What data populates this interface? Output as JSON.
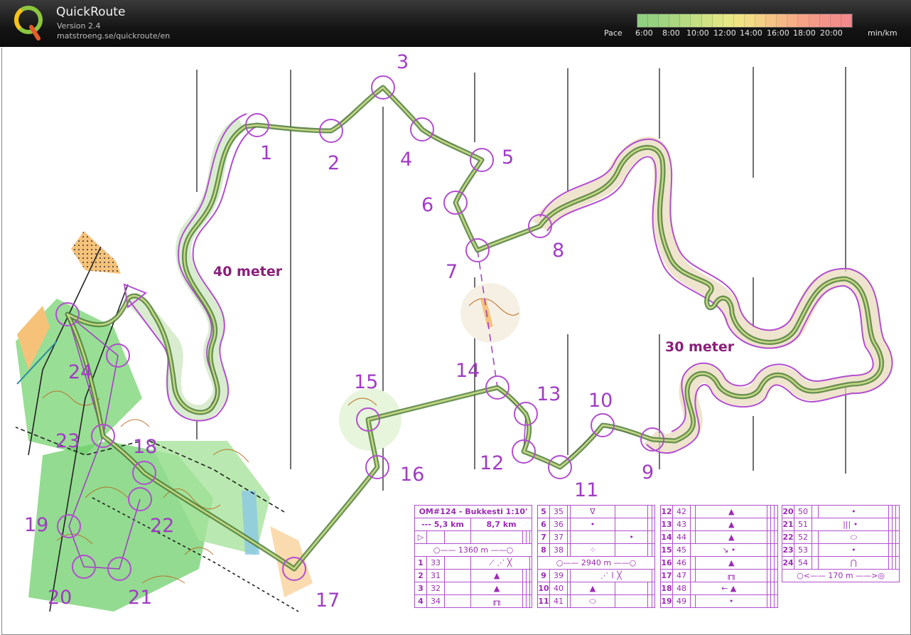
{
  "app": {
    "title": "QuickRoute",
    "version": "Version 2.4",
    "url": "matstroeng.se/quickroute/en"
  },
  "pace": {
    "label": "Pace",
    "ticks": [
      "6:00",
      "8:00",
      "10:00",
      "12:00",
      "14:00",
      "16:00",
      "18:00",
      "20:00"
    ],
    "unit": "min/km",
    "colors": [
      "#8fcf7f",
      "#96d180",
      "#a0d480",
      "#abd781",
      "#b7db82",
      "#c4de83",
      "#d1e284",
      "#dde585",
      "#e8e786",
      "#efe386",
      "#f2da86",
      "#f4cf86",
      "#f5c486",
      "#f6b986",
      "#f6ae87",
      "#f6a388",
      "#f59a89",
      "#f4938a",
      "#f38e8b",
      "#f2898c"
    ]
  },
  "map": {
    "route_color": "#4f7f3a",
    "course_color": "#a13bc4",
    "height_labels": [
      "40 meter",
      "30 meter"
    ],
    "controls": [
      {
        "label": "1"
      },
      {
        "label": "2"
      },
      {
        "label": "3"
      },
      {
        "label": "4"
      },
      {
        "label": "5"
      },
      {
        "label": "6"
      },
      {
        "label": "7"
      },
      {
        "label": "8"
      },
      {
        "label": "9"
      },
      {
        "label": "10"
      },
      {
        "label": "11"
      },
      {
        "label": "12"
      },
      {
        "label": "13"
      },
      {
        "label": "14"
      },
      {
        "label": "15"
      },
      {
        "label": "16"
      },
      {
        "label": "17"
      },
      {
        "label": "18"
      },
      {
        "label": "19"
      },
      {
        "label": "20"
      },
      {
        "label": "21"
      },
      {
        "label": "22"
      },
      {
        "label": "23"
      },
      {
        "label": "24"
      }
    ]
  },
  "descriptions": {
    "title": "OM#124 - Bukkesti 1:10'",
    "length1": "--- 5,3 km",
    "length2": "8,7 km",
    "leg1": "1360 m",
    "leg2": "2940 m",
    "leg3": "170 m",
    "col1": [
      {
        "n": "1",
        "code": "33",
        "sym": "⟋ ⋰ ╳"
      },
      {
        "n": "2",
        "code": "31",
        "sym": "▲"
      },
      {
        "n": "3",
        "code": "32",
        "sym": "▲"
      },
      {
        "n": "4",
        "code": "34",
        "sym": "╓╖"
      }
    ],
    "col2": [
      {
        "n": "5",
        "code": "35",
        "sym": "∇"
      },
      {
        "n": "6",
        "code": "36",
        "sym": "•"
      },
      {
        "n": "7",
        "code": "37",
        "sym": "•"
      },
      {
        "n": "8",
        "code": "38",
        "sym": "⁘"
      },
      {
        "n": "9",
        "code": "39",
        "sym": "⋰ ⌇ ╳"
      },
      {
        "n": "10",
        "code": "40",
        "sym": "▲"
      },
      {
        "n": "11",
        "code": "41",
        "sym": "⬭"
      }
    ],
    "col3": [
      {
        "n": "12",
        "code": "42",
        "sym": "▲"
      },
      {
        "n": "13",
        "code": "43",
        "sym": "▲"
      },
      {
        "n": "14",
        "code": "44",
        "sym": "▲"
      },
      {
        "n": "15",
        "code": "45",
        "sym": "↘ •"
      },
      {
        "n": "16",
        "code": "46",
        "sym": "▲"
      },
      {
        "n": "17",
        "code": "47",
        "sym": "╓╖"
      },
      {
        "n": "18",
        "code": "48",
        "sym": "← ▲"
      },
      {
        "n": "19",
        "code": "49",
        "sym": "•"
      }
    ],
    "col4": [
      {
        "n": "20",
        "code": "50",
        "sym": "•"
      },
      {
        "n": "21",
        "code": "51",
        "sym": "|||  •"
      },
      {
        "n": "22",
        "code": "52",
        "sym": "⬭"
      },
      {
        "n": "23",
        "code": "53",
        "sym": "•"
      },
      {
        "n": "24",
        "code": "54",
        "sym": "⋂"
      }
    ]
  }
}
